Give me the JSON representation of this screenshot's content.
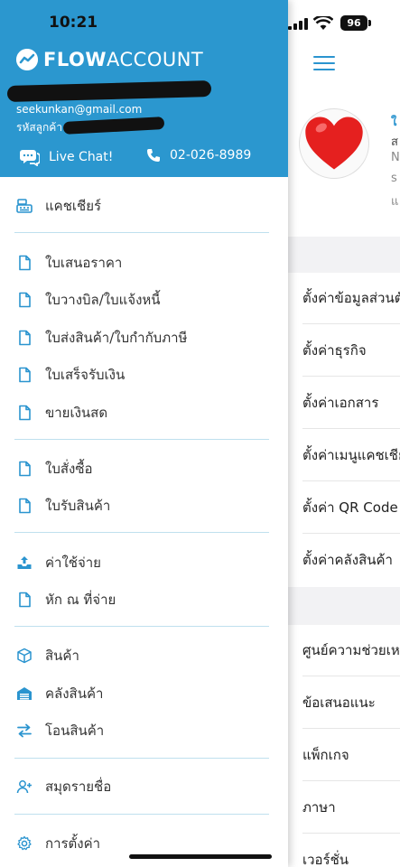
{
  "status_bar": {
    "time": "10:21",
    "battery": "96"
  },
  "drawer": {
    "brand": {
      "bold": "FLOW",
      "light": "ACCOUNT"
    },
    "email": "seekunkan@gmail.com",
    "customer_label": "รหัสลูกค้า",
    "live_chat_label": "Live Chat!",
    "phone": "02-026-8989",
    "menu": {
      "cashier": "แคชเชียร์",
      "quotation": "ใบเสนอราคา",
      "billing": "ใบวางบิล/ใบแจ้งหนี้",
      "tax_invoice": "ใบส่งสินค้า/ใบกำกับภาษี",
      "receipt": "ใบเสร็จรับเงิน",
      "cash_sale": "ขายเงินสด",
      "purchase_order": "ใบสั่งซื้อ",
      "goods_receipt": "ใบรับสินค้า",
      "expense": "ค่าใช้จ่าย",
      "withholding": "หัก ณ ที่จ่าย",
      "products": "สินค้า",
      "warehouse": "คลังสินค้า",
      "transfer": "โอนสินค้า",
      "contacts": "สมุดรายชื่อ",
      "settings": "การตั้งค่า"
    }
  },
  "right_page": {
    "peek": [
      "ใ",
      "ส",
      "N",
      "s",
      "แ"
    ],
    "settings_rows": [
      "ตั้งค่าข้อมูลส่วนตัว",
      "ตั้งค่าธุรกิจ",
      "ตั้งค่าเอกสาร",
      "ตั้งค่าเมนูแคชเชียร์",
      "ตั้งค่า QR Code",
      "ตั้งค่าคลังสินค้า"
    ],
    "help_rows": [
      "ศูนย์ความช่วยเหลือ",
      "ข้อเสนอแนะ",
      "แพ็กเกจ",
      "ภาษา",
      "เวอร์ชั่น"
    ]
  },
  "colors": {
    "brand_blue": "#2b97cf",
    "divider": "#bfe0ee",
    "icon_blue": "#2a94cf"
  }
}
